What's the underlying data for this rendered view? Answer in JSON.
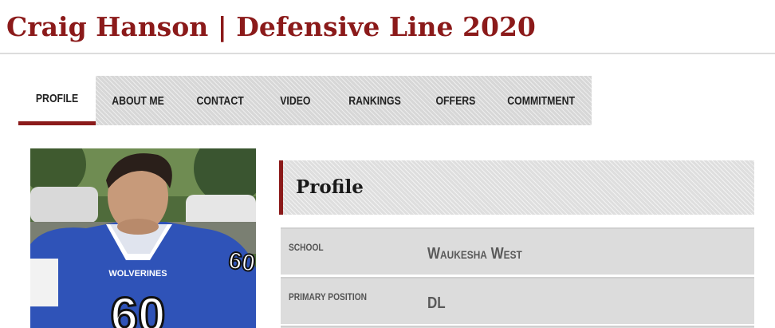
{
  "header": {
    "title": "Craig Hanson | Defensive Line 2020"
  },
  "tabs": [
    {
      "label": "Profile",
      "active": true
    },
    {
      "label": "About Me",
      "active": false
    },
    {
      "label": "Contact",
      "active": false
    },
    {
      "label": "Video",
      "active": false
    },
    {
      "label": "Rankings",
      "active": false
    },
    {
      "label": "Offers",
      "active": false
    },
    {
      "label": "Commitment",
      "active": false
    }
  ],
  "photo": {
    "jersey_team_text": "WOLVERINES",
    "jersey_number_front": "60",
    "jersey_number_sleeve": "60"
  },
  "profile": {
    "heading": "Profile",
    "rows": [
      {
        "label": "School",
        "value": "Waukesha West"
      },
      {
        "label": "Primary Position",
        "value": "DL"
      }
    ]
  },
  "colors": {
    "accent": "#8b1a1a",
    "tab_bar": "#d7d7d7",
    "row_bg": "#dcdcdc",
    "jersey_blue": "#2f53b8"
  }
}
